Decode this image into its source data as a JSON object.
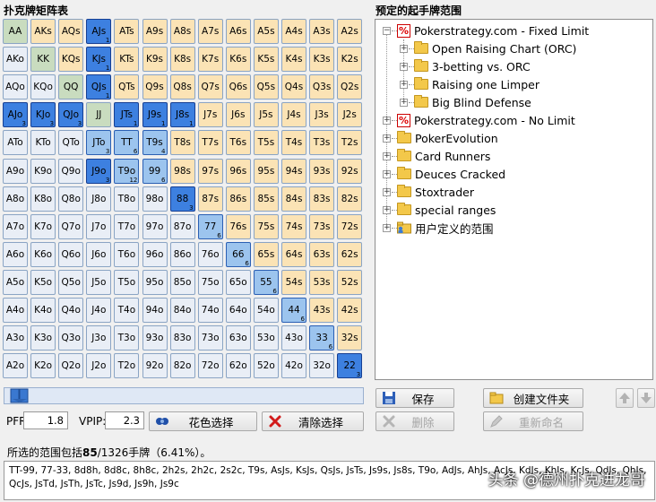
{
  "titles": {
    "matrix": "扑克牌矩阵表",
    "ranges": "预定的起手牌范围"
  },
  "matrix": {
    "ranks": [
      "A",
      "K",
      "Q",
      "J",
      "T",
      "9",
      "8",
      "7",
      "6",
      "5",
      "4",
      "3",
      "2"
    ],
    "selected": {
      "AJs": "1",
      "KJs": "1",
      "QJs": "1",
      "AJo": "3",
      "KJo": "3",
      "QJo": "3",
      "JTs": "1",
      "J9s": "1",
      "J8s": "1",
      "JTo": "3",
      "TT": "6",
      "T9s": "4",
      "J9o": "3",
      "T9o": "12",
      "99": "6",
      "88": "3",
      "77": "6",
      "66": "6",
      "55": "6",
      "44": "6",
      "33": "6",
      "22": "3"
    },
    "partial": [
      "JTo",
      "TT",
      "T9s",
      "T9o",
      "99",
      "77",
      "66",
      "55",
      "44",
      "33"
    ]
  },
  "tree": {
    "items": [
      {
        "label": "Pokerstrategy.com - Fixed Limit",
        "icon": "pokerstrategy-icon",
        "level": 0,
        "expanded": true
      },
      {
        "label": "Open Raising Chart (ORC)",
        "icon": "folder-icon",
        "level": 1
      },
      {
        "label": "3-betting vs. ORC",
        "icon": "folder-icon",
        "level": 1
      },
      {
        "label": "Raising one Limper",
        "icon": "folder-icon",
        "level": 1
      },
      {
        "label": "Big Blind Defense",
        "icon": "folder-icon",
        "level": 1
      },
      {
        "label": "Pokerstrategy.com - No Limit",
        "icon": "pokerstrategy-icon",
        "level": 0
      },
      {
        "label": "PokerEvolution",
        "icon": "folder-icon",
        "level": 0
      },
      {
        "label": "Card Runners",
        "icon": "folder-icon",
        "level": 0
      },
      {
        "label": "Deuces Cracked",
        "icon": "folder-icon",
        "level": 0
      },
      {
        "label": "Stoxtrader",
        "icon": "folder-icon",
        "level": 0
      },
      {
        "label": "special ranges",
        "icon": "folder-icon",
        "level": 0
      },
      {
        "label": "用户定义的范围",
        "icon": "user-folder-icon",
        "level": 0
      }
    ]
  },
  "controls": {
    "pfr_label": "PFR:",
    "pfr_value": "1.8",
    "vpip_label": "VPIP:",
    "vpip_value": "2.3",
    "suit_select": "花色选择",
    "clear_select": "清除选择",
    "save": "保存",
    "delete": "删除",
    "create_folder": "创建文件夹",
    "rename": "重新命名"
  },
  "summary": {
    "prefix": "所选的范围包括",
    "count": "85",
    "suffix": "/1326手牌（6.41%）。"
  },
  "hands_text": "TT-99, 77-33, 8d8h, 8d8c, 8h8c, 2h2s, 2h2c, 2s2c, T9s, AsJs, KsJs, QsJs, JsTs, Js9s, Js8s, T9o, AdJs, AhJs, AcJs, KdJs, KhJs, KcJs, QdJs, QhJs, QcJs, JsTd, JsTh, JsTc, Js9d, Js9h, Js9c",
  "watermark": "头条 @德州扑克进龙哥",
  "colors": {
    "pair": "#c9dcbf",
    "suited": "#fbe3b5",
    "offsuit": "#e9eef6",
    "selected": "#3d80e0"
  }
}
